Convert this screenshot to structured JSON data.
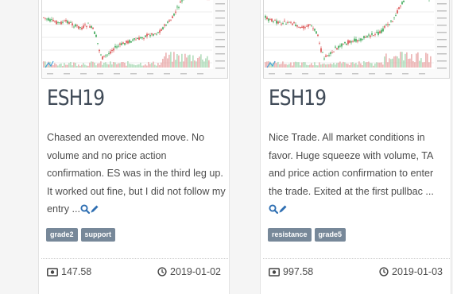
{
  "cards": [
    {
      "title": "ESH19",
      "description": "Chased an overextended move. No volume and no price action confirmation. ES was in the third leg up. It worked out fine, but I did not follow my entry ...",
      "tags": [
        "grade2",
        "support"
      ],
      "amount": "147.58",
      "date": "2019-01-02",
      "icons": [
        "chart-thumbnail",
        "search-icon",
        "pencil-icon",
        "money-icon",
        "clock-icon"
      ]
    },
    {
      "title": "ESH19",
      "description": "Nice Trade. All market conditions in favor. Huge squeeze with volume, TA and price action confirmation to enter the trade. Exited at the first pullbac ...",
      "tags": [
        "resistance",
        "grade5"
      ],
      "amount": "997.58",
      "date": "2019-01-03",
      "icons": [
        "chart-thumbnail",
        "search-icon",
        "pencil-icon",
        "money-icon",
        "clock-icon"
      ]
    }
  ],
  "colors": {
    "title": "#3f4a57",
    "tag_bg": "#778899",
    "icon_blue": "#2f6fb2",
    "bull": "#3aa655",
    "bear": "#d94a4a"
  }
}
